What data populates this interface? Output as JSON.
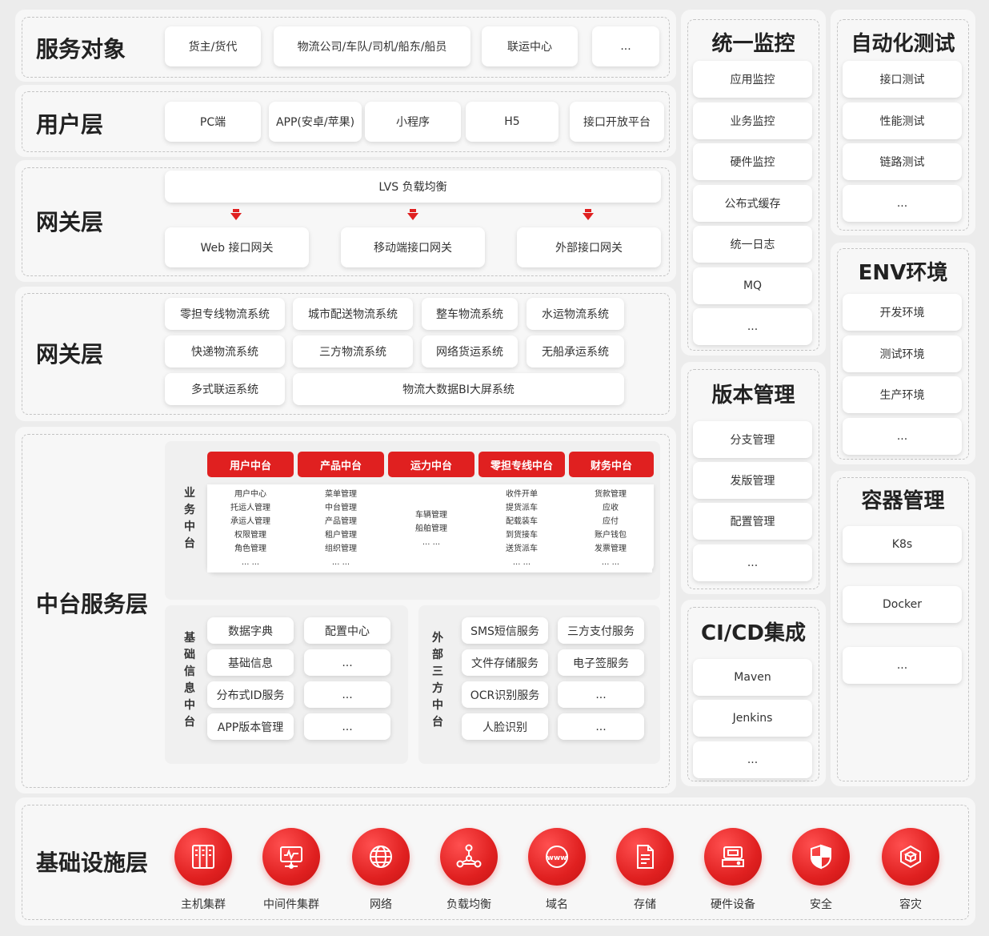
{
  "service_objects": {
    "title": "服务对象",
    "items": [
      "货主/货代",
      "物流公司/车队/司机/船东/船员",
      "联运中心",
      "..."
    ]
  },
  "user_layer": {
    "title": "用户层",
    "items": [
      "PC端",
      "APP(安卓/苹果)",
      "小程序",
      "H5",
      "接口开放平台"
    ]
  },
  "gateway_layer": {
    "title": "网关层",
    "lb": "LVS 负载均衡",
    "gateways": [
      "Web 接口网关",
      "移动端接口网关",
      "外部接口网关"
    ]
  },
  "system_layer": {
    "title": "网关层",
    "row1": [
      "零担专线物流系统",
      "城市配送物流系统",
      "整车物流系统",
      "水运物流系统"
    ],
    "row2": [
      "快递物流系统",
      "三方物流系统",
      "网络货运系统",
      "无船承运系统"
    ],
    "row3": [
      "多式联运系统",
      "物流大数据BI大屏系统"
    ]
  },
  "middle": {
    "title": "中台服务层",
    "business_label": "业务中台",
    "headers": [
      "用户中台",
      "产品中台",
      "运力中台",
      "零担专线中台",
      "财务中台"
    ],
    "cols": [
      [
        "用户中心",
        "托运人管理",
        "承运人管理",
        "权限管理",
        "角色管理",
        "... ..."
      ],
      [
        "菜单管理",
        "中台管理",
        "产品管理",
        "租户管理",
        "组织管理",
        "... ..."
      ],
      [
        "车辆管理",
        "船舶管理",
        "... ..."
      ],
      [
        "收件开单",
        "提货派车",
        "配载装车",
        "到货接车",
        "送货派车",
        "... ..."
      ],
      [
        "货款管理",
        "应收",
        "应付",
        "账户钱包",
        "发票管理",
        "... ..."
      ]
    ],
    "basic_label": "基础信息中台",
    "basic_left": [
      "数据字典",
      "基础信息",
      "分布式ID服务",
      "APP版本管理"
    ],
    "basic_right": [
      "配置中心",
      "...",
      "...",
      "..."
    ],
    "ext_label": "外部三方中台",
    "ext_left": [
      "SMS短信服务",
      "文件存储服务",
      "OCR识别服务",
      "人脸识别"
    ],
    "ext_right": [
      "三方支付服务",
      "电子签服务",
      "...",
      "..."
    ]
  },
  "monitor": {
    "title": "统一监控",
    "items": [
      "应用监控",
      "业务监控",
      "硬件监控",
      "公布式缓存",
      "统一日志",
      "MQ",
      "..."
    ]
  },
  "version": {
    "title": "版本管理",
    "items": [
      "分支管理",
      "发版管理",
      "配置管理",
      "..."
    ]
  },
  "cicd": {
    "title": "CI/CD集成",
    "items": [
      "Maven",
      "Jenkins",
      "..."
    ]
  },
  "autotest": {
    "title": "自动化测试",
    "items": [
      "接口测试",
      "性能测试",
      "链路测试",
      "..."
    ]
  },
  "env": {
    "title": "ENV环境",
    "items": [
      "开发环境",
      "测试环境",
      "生产环境",
      "..."
    ]
  },
  "container": {
    "title": "容器管理",
    "items": [
      "K8s",
      "Docker",
      "..."
    ]
  },
  "infra": {
    "title": "基础设施层",
    "items": [
      {
        "label": "主机集群",
        "icon": "server-rack-icon"
      },
      {
        "label": "中间件集群",
        "icon": "monitor-icon"
      },
      {
        "label": "网络",
        "icon": "globe-icon"
      },
      {
        "label": "负载均衡",
        "icon": "network-nodes-icon"
      },
      {
        "label": "域名",
        "icon": "www-icon"
      },
      {
        "label": "存储",
        "icon": "document-icon"
      },
      {
        "label": "硬件设备",
        "icon": "hard-drive-icon"
      },
      {
        "label": "安全",
        "icon": "shield-icon"
      },
      {
        "label": "容灾",
        "icon": "cube-icon"
      }
    ]
  },
  "colors": {
    "accent": "#e02020",
    "panel": "#f7f7f7",
    "background": "#ececec"
  }
}
